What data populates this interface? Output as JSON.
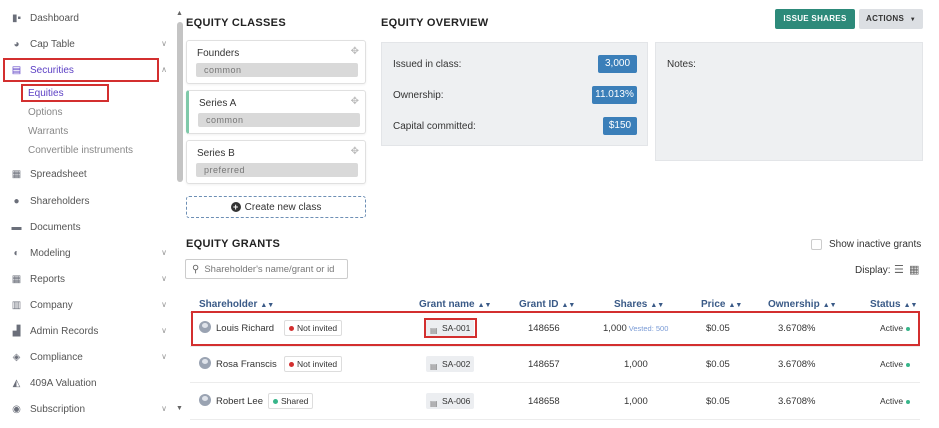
{
  "sidebar": {
    "items": [
      {
        "label": "Dashboard",
        "icon": "dashboard-icon",
        "glyph": "▮▪"
      },
      {
        "label": "Cap Table",
        "icon": "pie-chart-icon",
        "glyph": "◕"
      },
      {
        "label": "Securities",
        "icon": "clipboard-icon",
        "glyph": "▤"
      },
      {
        "label": "Spreadsheet",
        "icon": "spreadsheet-icon",
        "glyph": "▦"
      },
      {
        "label": "Shareholders",
        "icon": "user-icon",
        "glyph": "●"
      },
      {
        "label": "Documents",
        "icon": "folder-icon",
        "glyph": "▬"
      },
      {
        "label": "Modeling",
        "icon": "bulb-icon",
        "glyph": "◐"
      },
      {
        "label": "Reports",
        "icon": "report-icon",
        "glyph": "▦"
      },
      {
        "label": "Company",
        "icon": "building-icon",
        "glyph": "▥"
      },
      {
        "label": "Admin Records",
        "icon": "admin-icon",
        "glyph": "▟"
      },
      {
        "label": "Compliance",
        "icon": "shield-icon",
        "glyph": "◈"
      },
      {
        "label": "409A Valuation",
        "icon": "valuation-icon",
        "glyph": "◭"
      },
      {
        "label": "Subscription",
        "icon": "subscription-icon",
        "glyph": "◉"
      }
    ],
    "securities_sub": [
      "Equities",
      "Options",
      "Warrants",
      "Convertible instruments"
    ]
  },
  "equity_classes": {
    "title": "EQUITY CLASSES",
    "classes": [
      {
        "name": "Founders",
        "type": "common"
      },
      {
        "name": "Series A",
        "type": "common"
      },
      {
        "name": "Series B",
        "type": "preferred"
      }
    ],
    "create_label": "Create new class"
  },
  "overview": {
    "title": "EQUITY OVERVIEW",
    "issued_label": "Issued in class:",
    "issued_value": "3,000",
    "ownership_label": "Ownership:",
    "ownership_value": "11.013%",
    "capital_label": "Capital committed:",
    "capital_value": "$150",
    "notes_label": "Notes:"
  },
  "toolbar": {
    "issue_label": "ISSUE SHARES",
    "actions_label": "ACTIONS"
  },
  "grants": {
    "title": "EQUITY GRANTS",
    "show_inactive_label": "Show inactive grants",
    "search_placeholder": "Shareholder's name/grant or id",
    "display_label": "Display:",
    "columns": [
      "Shareholder",
      "Grant name",
      "Grant ID",
      "Shares",
      "Price",
      "Ownership",
      "Status"
    ],
    "rows": [
      {
        "name": "Louis Richard",
        "badge": "Not invited",
        "grant": "SA-001",
        "id": "148656",
        "shares": "1,000",
        "vested": "Vested: 500",
        "price": "$0.05",
        "ownership": "3.6708%",
        "status": "Active"
      },
      {
        "name": "Rosa Franscis",
        "badge": "Not invited",
        "grant": "SA-002",
        "id": "148657",
        "shares": "1,000",
        "vested": "",
        "price": "$0.05",
        "ownership": "3.6708%",
        "status": "Active"
      },
      {
        "name": "Robert Lee",
        "badge": "Shared",
        "grant": "SA-006",
        "id": "148658",
        "shares": "1,000",
        "vested": "",
        "price": "$0.05",
        "ownership": "3.6708%",
        "status": "Active"
      }
    ]
  },
  "colors": {
    "accent": "#5b3fc4",
    "highlight": "#d32f2f",
    "value_badge": "#3b7fb9",
    "issue_button": "#2d8a7a",
    "not_invited_dot": "#d32f2f",
    "shared_dot": "#38b58a",
    "active_dot": "#38b58a"
  }
}
